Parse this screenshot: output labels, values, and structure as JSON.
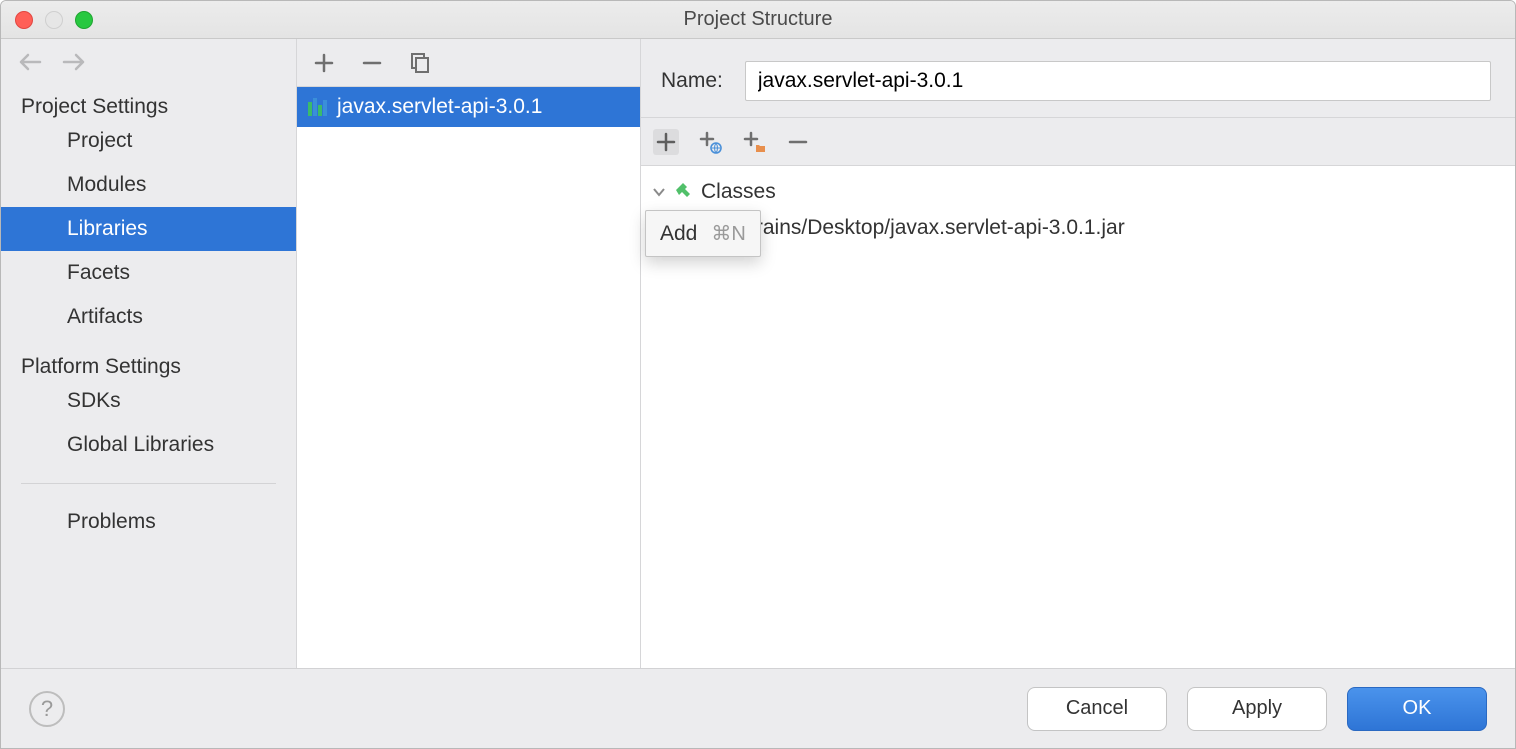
{
  "window": {
    "title": "Project Structure"
  },
  "sidebar": {
    "sections": {
      "project_settings": {
        "title": "Project Settings",
        "items": [
          {
            "label": "Project",
            "selected": false
          },
          {
            "label": "Modules",
            "selected": false
          },
          {
            "label": "Libraries",
            "selected": true
          },
          {
            "label": "Facets",
            "selected": false
          },
          {
            "label": "Artifacts",
            "selected": false
          }
        ]
      },
      "platform_settings": {
        "title": "Platform Settings",
        "items": [
          {
            "label": "SDKs",
            "selected": false
          },
          {
            "label": "Global Libraries",
            "selected": false
          }
        ]
      },
      "problems": {
        "label": "Problems"
      }
    }
  },
  "midlist": {
    "items": [
      {
        "label": "javax.servlet-api-3.0.1",
        "selected": true
      }
    ]
  },
  "detail": {
    "name_label": "Name:",
    "name_value": "javax.servlet-api-3.0.1",
    "tree": {
      "root_label": "Classes",
      "child_path": "ers/jetbrains/Desktop/javax.servlet-api-3.0.1.jar"
    },
    "popup": {
      "label": "Add",
      "shortcut": "⌘N"
    }
  },
  "footer": {
    "cancel": "Cancel",
    "apply": "Apply",
    "ok": "OK"
  }
}
